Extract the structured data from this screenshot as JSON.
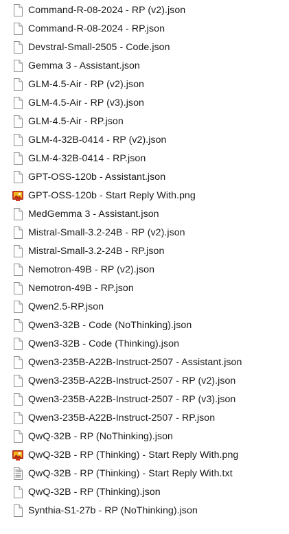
{
  "files": [
    {
      "name": "Command-R-08-2024 - RP (v2).json",
      "icon": "document-file-icon"
    },
    {
      "name": "Command-R-08-2024 - RP.json",
      "icon": "document-file-icon"
    },
    {
      "name": "Devstral-Small-2505 - Code.json",
      "icon": "document-file-icon"
    },
    {
      "name": "Gemma 3 - Assistant.json",
      "icon": "document-file-icon"
    },
    {
      "name": "GLM-4.5-Air - RP (v2).json",
      "icon": "document-file-icon"
    },
    {
      "name": "GLM-4.5-Air - RP (v3).json",
      "icon": "document-file-icon"
    },
    {
      "name": "GLM-4.5-Air - RP.json",
      "icon": "document-file-icon"
    },
    {
      "name": "GLM-4-32B-0414 - RP (v2).json",
      "icon": "document-file-icon"
    },
    {
      "name": "GLM-4-32B-0414 - RP.json",
      "icon": "document-file-icon"
    },
    {
      "name": "GPT-OSS-120b - Assistant.json",
      "icon": "document-file-icon"
    },
    {
      "name": "GPT-OSS-120b - Start Reply With.png",
      "icon": "image-file-icon"
    },
    {
      "name": "MedGemma 3 - Assistant.json",
      "icon": "document-file-icon"
    },
    {
      "name": "Mistral-Small-3.2-24B - RP (v2).json",
      "icon": "document-file-icon"
    },
    {
      "name": "Mistral-Small-3.2-24B - RP.json",
      "icon": "document-file-icon"
    },
    {
      "name": "Nemotron-49B - RP (v2).json",
      "icon": "document-file-icon"
    },
    {
      "name": "Nemotron-49B - RP.json",
      "icon": "document-file-icon"
    },
    {
      "name": "Qwen2.5-RP.json",
      "icon": "document-file-icon"
    },
    {
      "name": "Qwen3-32B - Code (NoThinking).json",
      "icon": "document-file-icon"
    },
    {
      "name": "Qwen3-32B - Code (Thinking).json",
      "icon": "document-file-icon"
    },
    {
      "name": "Qwen3-235B-A22B-Instruct-2507 - Assistant.json",
      "icon": "document-file-icon"
    },
    {
      "name": "Qwen3-235B-A22B-Instruct-2507 - RP (v2).json",
      "icon": "document-file-icon"
    },
    {
      "name": "Qwen3-235B-A22B-Instruct-2507 - RP (v3).json",
      "icon": "document-file-icon"
    },
    {
      "name": "Qwen3-235B-A22B-Instruct-2507 - RP.json",
      "icon": "document-file-icon"
    },
    {
      "name": "QwQ-32B - RP (NoThinking).json",
      "icon": "document-file-icon"
    },
    {
      "name": "QwQ-32B - RP (Thinking) - Start Reply With.png",
      "icon": "image-file-icon"
    },
    {
      "name": "QwQ-32B - RP (Thinking) - Start Reply With.txt",
      "icon": "text-file-icon"
    },
    {
      "name": "QwQ-32B - RP (Thinking).json",
      "icon": "document-file-icon"
    },
    {
      "name": "Synthia-S1-27b - RP (NoThinking).json",
      "icon": "document-file-icon"
    }
  ],
  "colors": {
    "text": "#1a1a1a",
    "doc_border": "#8c8c8c",
    "image_red": "#d23b1f",
    "image_yellow": "#f2b61f",
    "hover": "#e5f3ff"
  }
}
